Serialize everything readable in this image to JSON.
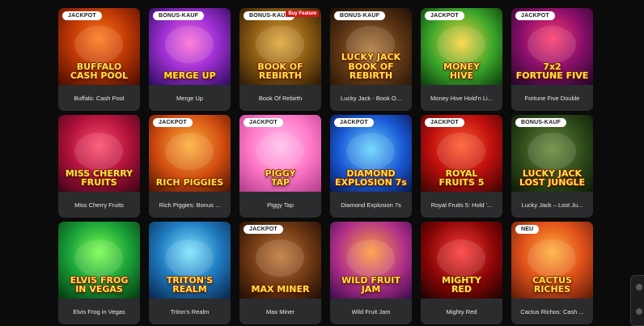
{
  "games": [
    {
      "label": "Buffalo: Cash Pool",
      "badge": "JACKPOT",
      "art_title": "BUFFALO\nCASH POOL",
      "bg": "radial-gradient(circle at 50% 40%, #ff7a1a 0%, #c23a05 45%, #4a0b02 100%)"
    },
    {
      "label": "Merge Up",
      "badge": "BONUS-KAUF",
      "art_title": "MERGE UP",
      "bg": "radial-gradient(circle at 50% 45%, #ff6fd3 0%, #a231d6 45%, #2c0b5e 100%)"
    },
    {
      "label": "Book Of Rebirth",
      "badge": "BONUS-KAUF",
      "corner": "Buy Feature",
      "art_title": "BOOK OF REBIRTH",
      "bg": "radial-gradient(circle at 50% 45%, #e0a83a 0%, #8a5a12 50%, #2a1703 100%)"
    },
    {
      "label": "Lucky Jack - Book O...",
      "badge": "BONUS-KAUF",
      "art_title": "LUCKY JACK\nBOOK OF REBIRTH",
      "bg": "radial-gradient(circle at 50% 55%, #b07a3a 0%, #5c3514 55%, #1f1006 100%)"
    },
    {
      "label": "Money Hive Hold'n Li...",
      "badge": "JACKPOT",
      "art_title": "MONEY\nHIVE",
      "bg": "radial-gradient(circle at 50% 45%, #ffd23a 0%, #3aa52a 55%, #0b3a0a 100%)"
    },
    {
      "label": "Fortune Five Double",
      "badge": "JACKPOT",
      "art_title": "7x2\nFORTUNE FIVE",
      "bg": "radial-gradient(circle at 50% 40%, #ff3b6a 0%, #8a0f6a 50%, #200629 100%)"
    },
    {
      "label": "Miss Cherry Fruits",
      "art_title": "MISS CHERRY\nFRUITS",
      "bg": "radial-gradient(circle at 50% 40%, #ff4b6a 0%, #b0123c 50%, #3a0414 100%)"
    },
    {
      "label": "Rich Piggies: Bonus ...",
      "badge": "JACKPOT",
      "art_title": "RICH PIGGIES",
      "bg": "radial-gradient(circle at 50% 40%, #ffb13a 0%, #d04a10 55%, #4a1303 100%)"
    },
    {
      "label": "Piggy Tap",
      "badge": "JACKPOT",
      "art_title": "PIGGY\nTAP",
      "bg": "radial-gradient(circle at 50% 40%, #ffc1ee 0%, #ff7ac8 50%, #b23a8a 100%)"
    },
    {
      "label": "Diamond Explosion 7s",
      "badge": "JACKPOT",
      "art_title": "DIAMOND\nEXPLOSION 7s",
      "bg": "radial-gradient(circle at 50% 45%, #66d4ff 0%, #1a5ad6 55%, #0a1650 100%)"
    },
    {
      "label": "Royal Fruits 5: Hold '...",
      "badge": "JACKPOT",
      "art_title": "ROYAL\nFRUITS 5",
      "bg": "radial-gradient(circle at 50% 40%, #ff5a2a 0%, #c0100e 50%, #3a0303 100%)"
    },
    {
      "label": "Lucky Jack – Lost Ju...",
      "badge": "BONUS-KAUF",
      "art_title": "LUCKY JACK\nLOST JUNGLE",
      "bg": "radial-gradient(circle at 50% 45%, #6a8a3a 0%, #2d4a1a 55%, #0d1a06 100%)"
    },
    {
      "label": "Elvis Frog in Vegas",
      "art_title": "ELVIS FROG\nIN VEGAS",
      "bg": "radial-gradient(circle at 50% 40%, #7aff4a 0%, #1aa13a 50%, #06360f 100%)"
    },
    {
      "label": "Triton's Realm",
      "art_title": "TRITON'S REALM",
      "bg": "radial-gradient(circle at 50% 40%, #7fe6ff 0%, #1f7ac0 50%, #07264a 100%)"
    },
    {
      "label": "Max Miner",
      "badge": "JACKPOT",
      "art_title": "MAX MINER",
      "bg": "radial-gradient(circle at 50% 45%, #c0783a 0%, #6a3512 55%, #1f0c04 100%)"
    },
    {
      "label": "Wild Fruit Jam",
      "art_title": "WILD FRUIT JAM",
      "bg": "radial-gradient(circle at 50% 40%, #ff9a3a 0%, #b0308a 55%, #3a0a4a 100%)"
    },
    {
      "label": "Mighty Red",
      "art_title": "MIGHTY\nRED",
      "bg": "radial-gradient(circle at 50% 40%, #ff3a3a 0%, #8a0606 55%, #1a0202 100%)"
    },
    {
      "label": "Cactus Richos: Cash ...",
      "badge": "NEU",
      "art_title": "CACTUS\nRICHES",
      "bg": "radial-gradient(circle at 50% 40%, #ffb03a 0%, #e0501a 50%, #5a1a06 100%)"
    }
  ],
  "side_widget": {
    "icon": "chat-bubble-icon"
  }
}
